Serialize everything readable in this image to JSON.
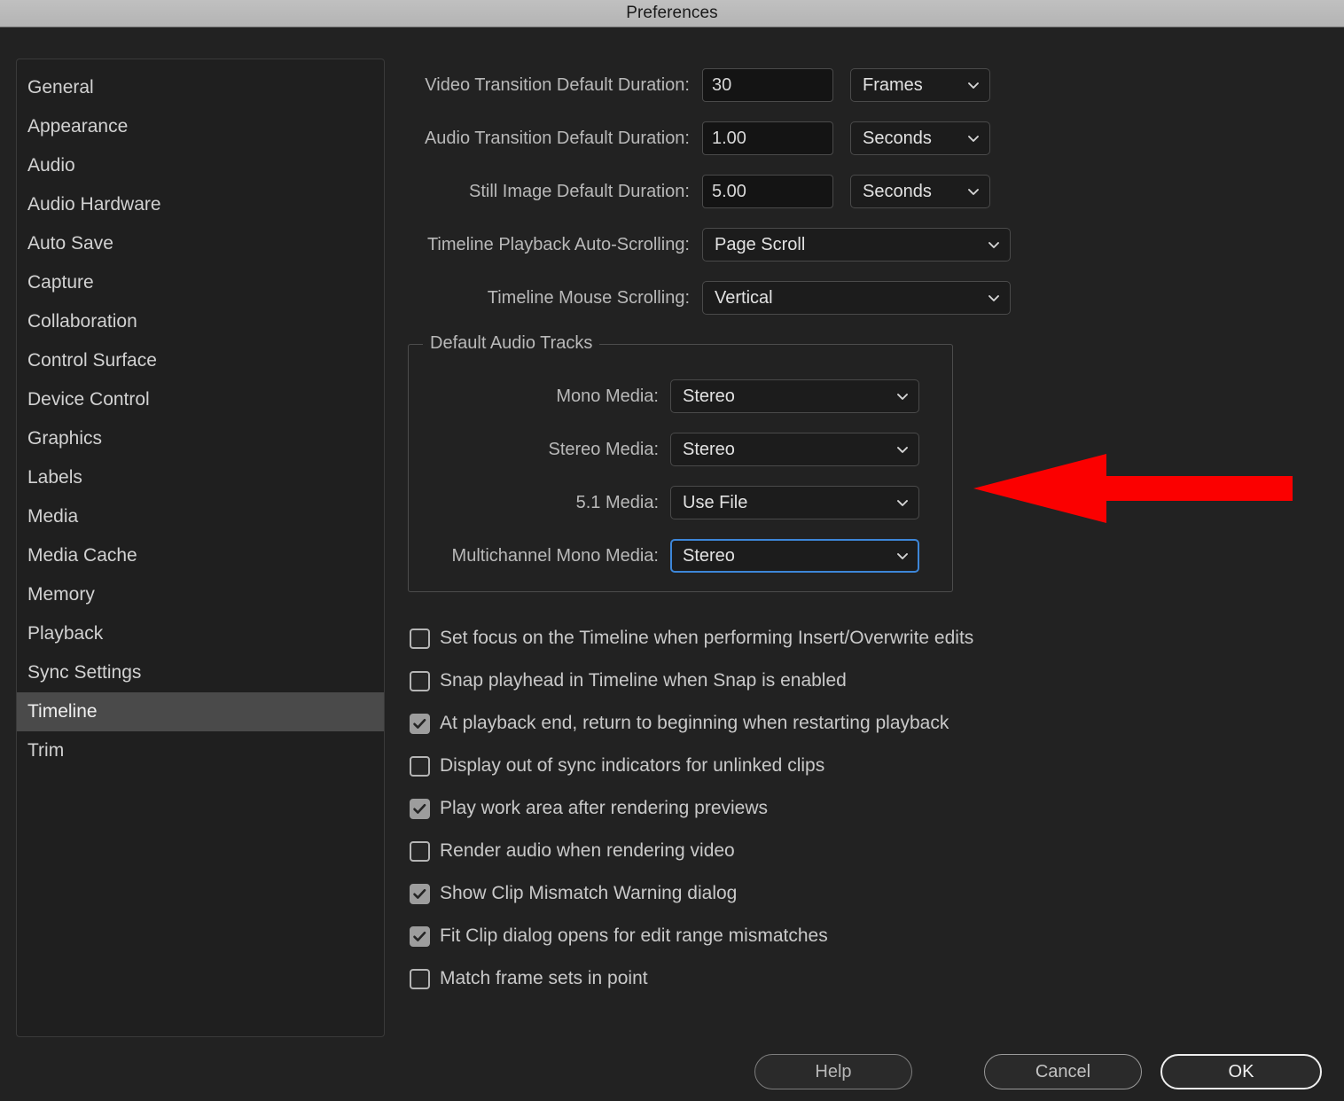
{
  "window": {
    "title": "Preferences"
  },
  "sidebar": {
    "items": [
      {
        "label": "General",
        "selected": false
      },
      {
        "label": "Appearance",
        "selected": false
      },
      {
        "label": "Audio",
        "selected": false
      },
      {
        "label": "Audio Hardware",
        "selected": false
      },
      {
        "label": "Auto Save",
        "selected": false
      },
      {
        "label": "Capture",
        "selected": false
      },
      {
        "label": "Collaboration",
        "selected": false
      },
      {
        "label": "Control Surface",
        "selected": false
      },
      {
        "label": "Device Control",
        "selected": false
      },
      {
        "label": "Graphics",
        "selected": false
      },
      {
        "label": "Labels",
        "selected": false
      },
      {
        "label": "Media",
        "selected": false
      },
      {
        "label": "Media Cache",
        "selected": false
      },
      {
        "label": "Memory",
        "selected": false
      },
      {
        "label": "Playback",
        "selected": false
      },
      {
        "label": "Sync Settings",
        "selected": false
      },
      {
        "label": "Timeline",
        "selected": true
      },
      {
        "label": "Trim",
        "selected": false
      }
    ]
  },
  "main": {
    "duration_fields": [
      {
        "label": "Video Transition Default Duration:",
        "value": "30",
        "unit": "Frames"
      },
      {
        "label": "Audio Transition Default Duration:",
        "value": "1.00",
        "unit": "Seconds"
      },
      {
        "label": "Still Image Default Duration:",
        "value": "5.00",
        "unit": "Seconds"
      }
    ],
    "scroll_fields": [
      {
        "label": "Timeline Playback Auto-Scrolling:",
        "value": "Page Scroll"
      },
      {
        "label": "Timeline Mouse Scrolling:",
        "value": "Vertical"
      }
    ],
    "default_audio_tracks": {
      "legend": "Default Audio Tracks",
      "rows": [
        {
          "label": "Mono Media:",
          "value": "Stereo",
          "focused": false
        },
        {
          "label": "Stereo Media:",
          "value": "Stereo",
          "focused": false
        },
        {
          "label": "5.1 Media:",
          "value": "Use File",
          "focused": false
        },
        {
          "label": "Multichannel Mono Media:",
          "value": "Stereo",
          "focused": true
        }
      ]
    },
    "checkboxes": [
      {
        "label": "Set focus on the Timeline when performing Insert/Overwrite edits",
        "checked": false
      },
      {
        "label": "Snap playhead in Timeline when Snap is enabled",
        "checked": false
      },
      {
        "label": "At playback end, return to beginning when restarting playback",
        "checked": true
      },
      {
        "label": "Display out of sync indicators for unlinked clips",
        "checked": false
      },
      {
        "label": "Play work area after rendering previews",
        "checked": true
      },
      {
        "label": "Render audio when rendering video",
        "checked": false
      },
      {
        "label": "Show Clip Mismatch Warning dialog",
        "checked": true
      },
      {
        "label": "Fit Clip dialog opens for edit range mismatches",
        "checked": true
      },
      {
        "label": "Match frame sets in point",
        "checked": false
      }
    ]
  },
  "annotation": {
    "arrow_color": "#fb0000",
    "arrow_direction": "left"
  },
  "footer": {
    "help_label": "Help",
    "cancel_label": "Cancel",
    "ok_label": "OK"
  },
  "colors": {
    "background": "#222222",
    "titlebar": "#b8b8b8",
    "selection": "#4a4a4a",
    "focus_blue": "#3d86d8",
    "arrow_red": "#fb0000"
  }
}
